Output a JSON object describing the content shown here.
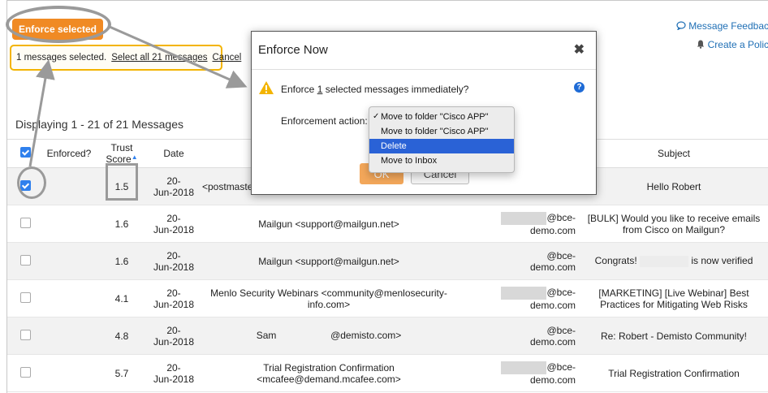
{
  "toolbar": {
    "enforce_label": "Enforce selected"
  },
  "selection": {
    "count_text": "1 messages selected.",
    "select_all": "Select all 21 messages",
    "cancel": "Cancel"
  },
  "top_links": {
    "feedback": "Message Feedbac",
    "create_policy": "Create a Polic"
  },
  "list": {
    "displaying": "Displaying 1 - 21 of 21 Messages"
  },
  "table": {
    "headers": {
      "enforced": "Enforced?",
      "trust_score": "Trust Score",
      "date": "Date",
      "subject": "Subject"
    },
    "rows": [
      {
        "checked": true,
        "score": "1.5",
        "date": "20-\nJun-2018",
        "from": "<postmaster",
        "to": "",
        "subject": "Hello Robert"
      },
      {
        "checked": false,
        "score": "1.6",
        "date": "20-\nJun-2018",
        "from": "Mailgun <support@mailgun.net>",
        "to": "@bce-\ndemo.com",
        "subject": "[BULK] Would you like to receive emails from Cisco on Mailgun?"
      },
      {
        "checked": false,
        "score": "1.6",
        "date": "20-\nJun-2018",
        "from": "Mailgun <support@mailgun.net>",
        "to": "@bce-\ndemo.com",
        "subject_a": "Congrats!",
        "subject_b": "is now verified"
      },
      {
        "checked": false,
        "score": "4.1",
        "date": "20-\nJun-2018",
        "from": "Menlo Security Webinars <community@menlosecurity-info.com>",
        "to": "@bce-\ndemo.com",
        "subject": "[MARKETING] [Live Webinar] Best Practices for Mitigating Web Risks"
      },
      {
        "checked": false,
        "score": "4.8",
        "date": "20-\nJun-2018",
        "from_a": "Sam",
        "from_b": "@demisto.com>",
        "to": "@bce-\ndemo.com",
        "subject": "Re: Robert - Demisto Community!"
      },
      {
        "checked": false,
        "score": "5.7",
        "date": "20-\nJun-2018",
        "from": "Trial Registration Confirmation <mcafee@demand.mcafee.com>",
        "to": "@bce-\ndemo.com",
        "subject": "Trial Registration Confirmation"
      }
    ]
  },
  "modal": {
    "title": "Enforce Now",
    "question_pre": "Enforce ",
    "question_num": "1",
    "question_post": " selected messages immediately?",
    "action_label": "Enforcement action:",
    "options": [
      "Move to folder \"Cisco APP\"",
      "Move to folder \"Cisco APP\"",
      "Delete",
      "Move to Inbox"
    ],
    "ok": "OK",
    "cancel": "Cancel"
  },
  "colors": {
    "accent": "#f08a24",
    "highlight": "#2a62d6",
    "link": "#1f6fb5",
    "warning": "#f3b400"
  }
}
